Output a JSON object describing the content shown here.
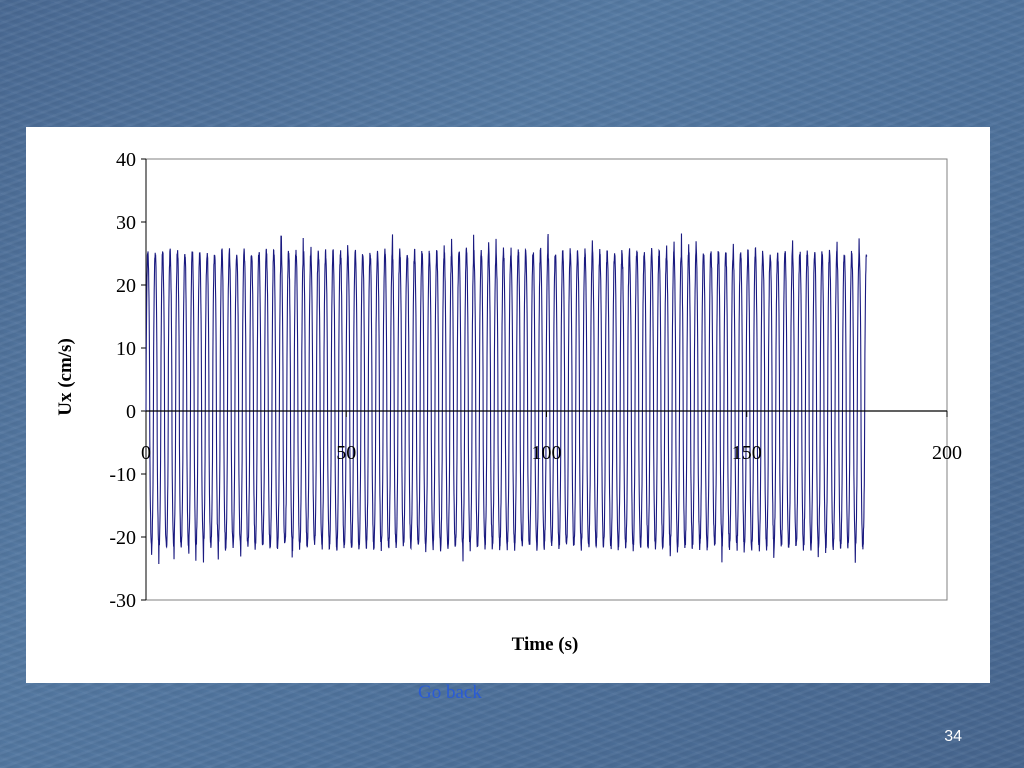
{
  "slide": {
    "link_label": "Go back",
    "number": "34"
  },
  "chart_data": {
    "type": "line",
    "title": "",
    "xlabel": "Time (s)",
    "ylabel": "Ux (cm/s)",
    "xlim": [
      0,
      200
    ],
    "ylim": [
      -30,
      40
    ],
    "x_ticks": [
      0,
      50,
      100,
      150,
      200
    ],
    "y_ticks": [
      -30,
      -20,
      -10,
      0,
      10,
      20,
      30,
      40
    ],
    "grid": false,
    "legend": "none",
    "series": [
      {
        "color": "#1a1a80",
        "x_range": [
          0,
          180
        ],
        "period": 1.85,
        "upper_envelope": 25.2,
        "lower_envelope": -21.5,
        "max": 28.2,
        "min": -24.5
      }
    ]
  }
}
